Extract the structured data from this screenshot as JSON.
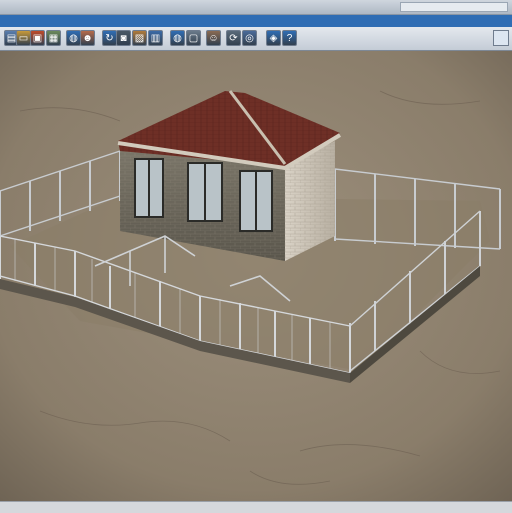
{
  "window": {
    "title": "",
    "title_right": ""
  },
  "menu": {
    "items": []
  },
  "toolbar": {
    "buttons": [
      {
        "icon": "document-icon",
        "color": "#5a7fb0"
      },
      {
        "icon": "open-folder-icon",
        "color": "#c89a3a"
      },
      {
        "icon": "save-icon",
        "color": "#c04a2a"
      },
      {
        "icon": "print-icon",
        "color": "#6c8a5a"
      },
      {
        "icon": "globe-icon",
        "color": "#2f6db4"
      },
      {
        "icon": "person-icon",
        "color": "#b56a4a"
      },
      {
        "icon": "refresh-icon",
        "color": "#2f6db4"
      },
      {
        "icon": "camera-icon",
        "color": "#4a5866"
      },
      {
        "icon": "image-icon",
        "color": "#b07a3a"
      },
      {
        "icon": "chart-icon",
        "color": "#3a6aa8"
      },
      {
        "icon": "globe-icon",
        "color": "#2f6db4"
      },
      {
        "icon": "paste-icon",
        "color": "#6a7a8a"
      },
      {
        "icon": "user-icon",
        "color": "#8a6a52"
      },
      {
        "icon": "rotate-icon",
        "color": "#5a6a7a"
      },
      {
        "icon": "orbit-icon",
        "color": "#4a6a9a"
      },
      {
        "icon": "layers-icon",
        "color": "#2f6db4"
      },
      {
        "icon": "help-icon",
        "color": "#2f6db4"
      }
    ],
    "end_icon": "window-icon"
  },
  "viewport": {
    "scene": "3d-house-model",
    "colors": {
      "ground": "#8e8170",
      "roof": "#6e2f26",
      "wall": "#cfc7ba",
      "fence": "#c6c9cc"
    }
  },
  "status": {
    "text": ""
  }
}
